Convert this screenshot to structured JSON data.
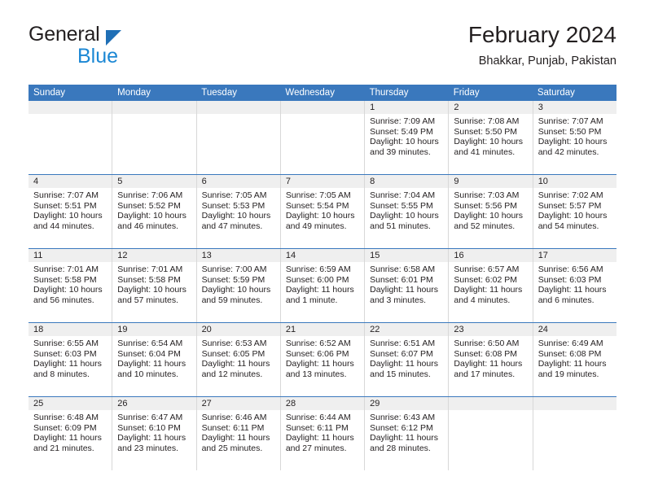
{
  "brand": {
    "name_top": "General",
    "name_bottom": "Blue",
    "triangle_color": "#1f6fb6",
    "blue_color": "#1b87d4"
  },
  "header": {
    "title": "February 2024",
    "subtitle": "Bhakkar, Punjab, Pakistan"
  },
  "theme": {
    "header_blue": "#3a78bd",
    "day_strip_gray": "#efefef",
    "grid_line": "#d8d8d8",
    "text": "#231f20"
  },
  "weekdays": [
    "Sunday",
    "Monday",
    "Tuesday",
    "Wednesday",
    "Thursday",
    "Friday",
    "Saturday"
  ],
  "weeks": [
    [
      {
        "date": "",
        "sunrise": "",
        "sunset": "",
        "daylight_line1": "",
        "daylight_line2": ""
      },
      {
        "date": "",
        "sunrise": "",
        "sunset": "",
        "daylight_line1": "",
        "daylight_line2": ""
      },
      {
        "date": "",
        "sunrise": "",
        "sunset": "",
        "daylight_line1": "",
        "daylight_line2": ""
      },
      {
        "date": "",
        "sunrise": "",
        "sunset": "",
        "daylight_line1": "",
        "daylight_line2": ""
      },
      {
        "date": "1",
        "sunrise": "Sunrise: 7:09 AM",
        "sunset": "Sunset: 5:49 PM",
        "daylight_line1": "Daylight: 10 hours",
        "daylight_line2": "and 39 minutes."
      },
      {
        "date": "2",
        "sunrise": "Sunrise: 7:08 AM",
        "sunset": "Sunset: 5:50 PM",
        "daylight_line1": "Daylight: 10 hours",
        "daylight_line2": "and 41 minutes."
      },
      {
        "date": "3",
        "sunrise": "Sunrise: 7:07 AM",
        "sunset": "Sunset: 5:50 PM",
        "daylight_line1": "Daylight: 10 hours",
        "daylight_line2": "and 42 minutes."
      }
    ],
    [
      {
        "date": "4",
        "sunrise": "Sunrise: 7:07 AM",
        "sunset": "Sunset: 5:51 PM",
        "daylight_line1": "Daylight: 10 hours",
        "daylight_line2": "and 44 minutes."
      },
      {
        "date": "5",
        "sunrise": "Sunrise: 7:06 AM",
        "sunset": "Sunset: 5:52 PM",
        "daylight_line1": "Daylight: 10 hours",
        "daylight_line2": "and 46 minutes."
      },
      {
        "date": "6",
        "sunrise": "Sunrise: 7:05 AM",
        "sunset": "Sunset: 5:53 PM",
        "daylight_line1": "Daylight: 10 hours",
        "daylight_line2": "and 47 minutes."
      },
      {
        "date": "7",
        "sunrise": "Sunrise: 7:05 AM",
        "sunset": "Sunset: 5:54 PM",
        "daylight_line1": "Daylight: 10 hours",
        "daylight_line2": "and 49 minutes."
      },
      {
        "date": "8",
        "sunrise": "Sunrise: 7:04 AM",
        "sunset": "Sunset: 5:55 PM",
        "daylight_line1": "Daylight: 10 hours",
        "daylight_line2": "and 51 minutes."
      },
      {
        "date": "9",
        "sunrise": "Sunrise: 7:03 AM",
        "sunset": "Sunset: 5:56 PM",
        "daylight_line1": "Daylight: 10 hours",
        "daylight_line2": "and 52 minutes."
      },
      {
        "date": "10",
        "sunrise": "Sunrise: 7:02 AM",
        "sunset": "Sunset: 5:57 PM",
        "daylight_line1": "Daylight: 10 hours",
        "daylight_line2": "and 54 minutes."
      }
    ],
    [
      {
        "date": "11",
        "sunrise": "Sunrise: 7:01 AM",
        "sunset": "Sunset: 5:58 PM",
        "daylight_line1": "Daylight: 10 hours",
        "daylight_line2": "and 56 minutes."
      },
      {
        "date": "12",
        "sunrise": "Sunrise: 7:01 AM",
        "sunset": "Sunset: 5:58 PM",
        "daylight_line1": "Daylight: 10 hours",
        "daylight_line2": "and 57 minutes."
      },
      {
        "date": "13",
        "sunrise": "Sunrise: 7:00 AM",
        "sunset": "Sunset: 5:59 PM",
        "daylight_line1": "Daylight: 10 hours",
        "daylight_line2": "and 59 minutes."
      },
      {
        "date": "14",
        "sunrise": "Sunrise: 6:59 AM",
        "sunset": "Sunset: 6:00 PM",
        "daylight_line1": "Daylight: 11 hours",
        "daylight_line2": "and 1 minute."
      },
      {
        "date": "15",
        "sunrise": "Sunrise: 6:58 AM",
        "sunset": "Sunset: 6:01 PM",
        "daylight_line1": "Daylight: 11 hours",
        "daylight_line2": "and 3 minutes."
      },
      {
        "date": "16",
        "sunrise": "Sunrise: 6:57 AM",
        "sunset": "Sunset: 6:02 PM",
        "daylight_line1": "Daylight: 11 hours",
        "daylight_line2": "and 4 minutes."
      },
      {
        "date": "17",
        "sunrise": "Sunrise: 6:56 AM",
        "sunset": "Sunset: 6:03 PM",
        "daylight_line1": "Daylight: 11 hours",
        "daylight_line2": "and 6 minutes."
      }
    ],
    [
      {
        "date": "18",
        "sunrise": "Sunrise: 6:55 AM",
        "sunset": "Sunset: 6:03 PM",
        "daylight_line1": "Daylight: 11 hours",
        "daylight_line2": "and 8 minutes."
      },
      {
        "date": "19",
        "sunrise": "Sunrise: 6:54 AM",
        "sunset": "Sunset: 6:04 PM",
        "daylight_line1": "Daylight: 11 hours",
        "daylight_line2": "and 10 minutes."
      },
      {
        "date": "20",
        "sunrise": "Sunrise: 6:53 AM",
        "sunset": "Sunset: 6:05 PM",
        "daylight_line1": "Daylight: 11 hours",
        "daylight_line2": "and 12 minutes."
      },
      {
        "date": "21",
        "sunrise": "Sunrise: 6:52 AM",
        "sunset": "Sunset: 6:06 PM",
        "daylight_line1": "Daylight: 11 hours",
        "daylight_line2": "and 13 minutes."
      },
      {
        "date": "22",
        "sunrise": "Sunrise: 6:51 AM",
        "sunset": "Sunset: 6:07 PM",
        "daylight_line1": "Daylight: 11 hours",
        "daylight_line2": "and 15 minutes."
      },
      {
        "date": "23",
        "sunrise": "Sunrise: 6:50 AM",
        "sunset": "Sunset: 6:08 PM",
        "daylight_line1": "Daylight: 11 hours",
        "daylight_line2": "and 17 minutes."
      },
      {
        "date": "24",
        "sunrise": "Sunrise: 6:49 AM",
        "sunset": "Sunset: 6:08 PM",
        "daylight_line1": "Daylight: 11 hours",
        "daylight_line2": "and 19 minutes."
      }
    ],
    [
      {
        "date": "25",
        "sunrise": "Sunrise: 6:48 AM",
        "sunset": "Sunset: 6:09 PM",
        "daylight_line1": "Daylight: 11 hours",
        "daylight_line2": "and 21 minutes."
      },
      {
        "date": "26",
        "sunrise": "Sunrise: 6:47 AM",
        "sunset": "Sunset: 6:10 PM",
        "daylight_line1": "Daylight: 11 hours",
        "daylight_line2": "and 23 minutes."
      },
      {
        "date": "27",
        "sunrise": "Sunrise: 6:46 AM",
        "sunset": "Sunset: 6:11 PM",
        "daylight_line1": "Daylight: 11 hours",
        "daylight_line2": "and 25 minutes."
      },
      {
        "date": "28",
        "sunrise": "Sunrise: 6:44 AM",
        "sunset": "Sunset: 6:11 PM",
        "daylight_line1": "Daylight: 11 hours",
        "daylight_line2": "and 27 minutes."
      },
      {
        "date": "29",
        "sunrise": "Sunrise: 6:43 AM",
        "sunset": "Sunset: 6:12 PM",
        "daylight_line1": "Daylight: 11 hours",
        "daylight_line2": "and 28 minutes."
      },
      {
        "date": "",
        "sunrise": "",
        "sunset": "",
        "daylight_line1": "",
        "daylight_line2": ""
      },
      {
        "date": "",
        "sunrise": "",
        "sunset": "",
        "daylight_line1": "",
        "daylight_line2": ""
      }
    ]
  ]
}
